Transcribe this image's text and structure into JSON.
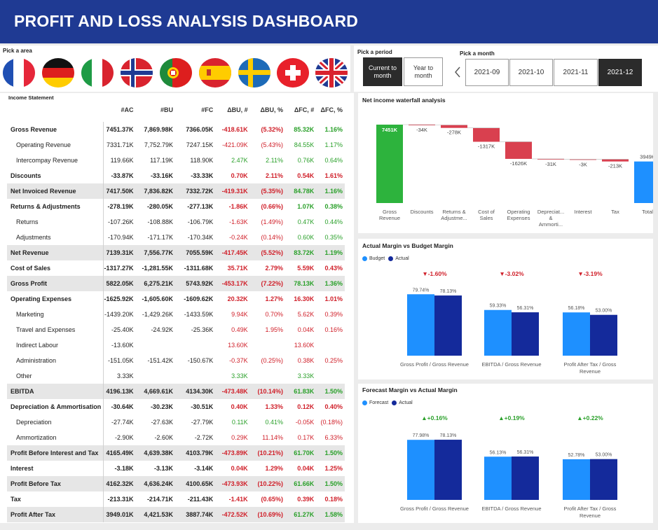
{
  "header": {
    "title": "PROFIT AND LOSS ANALYSIS DASHBOARD"
  },
  "area": {
    "label": "Pick a area",
    "flags": [
      "France",
      "Germany",
      "Italy",
      "Norway",
      "Portugal",
      "Spain",
      "Sweden",
      "Switzerland",
      "United Kingdom"
    ]
  },
  "period": {
    "label": "Pick a period",
    "options": [
      "Current to month",
      "Year to month"
    ],
    "selected": "Current to month"
  },
  "month": {
    "label": "Pick a month",
    "options": [
      "2021-09",
      "2021-10",
      "2021-11",
      "2021-12"
    ],
    "selected": "2021-12",
    "prev_icon": "chevron-left-icon"
  },
  "income": {
    "title": "Income Statement",
    "columns": [
      "#AC",
      "#BU",
      "#FC",
      "ΔBU, #",
      "ΔBU, %",
      "ΔFC, #",
      "ΔFC, %"
    ],
    "rows": [
      {
        "label": "Gross Revenue",
        "vals": [
          "7451.37K",
          "7,869.98K",
          "7366.05K",
          "-418.61K",
          "(5.32%)",
          "85.32K",
          "1.16%"
        ],
        "bold": true,
        "sub": false,
        "shade": false
      },
      {
        "label": "Operating Revenue",
        "vals": [
          "7331.71K",
          "7,752.79K",
          "7247.15K",
          "-421.09K",
          "(5.43%)",
          "84.55K",
          "1.17%"
        ],
        "bold": false,
        "sub": true,
        "shade": false
      },
      {
        "label": "Intercompay Revenue",
        "vals": [
          "119.66K",
          "117.19K",
          "118.90K",
          "2.47K",
          "2.11%",
          "0.76K",
          "0.64%"
        ],
        "bold": false,
        "sub": true,
        "shade": false
      },
      {
        "label": "Discounts",
        "vals": [
          "-33.87K",
          "-33.16K",
          "-33.33K",
          "0.70K",
          "2.11%",
          "0.54K",
          "1.61%"
        ],
        "bold": true,
        "sub": false,
        "shade": false
      },
      {
        "label": "Net Invoiced Revenue",
        "vals": [
          "7417.50K",
          "7,836.82K",
          "7332.72K",
          "-419.31K",
          "(5.35%)",
          "84.78K",
          "1.16%"
        ],
        "bold": true,
        "sub": false,
        "shade": true
      },
      {
        "label": "Returns & Adjustments",
        "vals": [
          "-278.19K",
          "-280.05K",
          "-277.13K",
          "-1.86K",
          "(0.66%)",
          "1.07K",
          "0.38%"
        ],
        "bold": true,
        "sub": false,
        "shade": false
      },
      {
        "label": "Returns",
        "vals": [
          "-107.26K",
          "-108.88K",
          "-106.79K",
          "-1.63K",
          "(1.49%)",
          "0.47K",
          "0.44%"
        ],
        "bold": false,
        "sub": true,
        "shade": false
      },
      {
        "label": "Adjustments",
        "vals": [
          "-170.94K",
          "-171.17K",
          "-170.34K",
          "-0.24K",
          "(0.14%)",
          "0.60K",
          "0.35%"
        ],
        "bold": false,
        "sub": true,
        "shade": false
      },
      {
        "label": "Net Revenue",
        "vals": [
          "7139.31K",
          "7,556.77K",
          "7055.59K",
          "-417.45K",
          "(5.52%)",
          "83.72K",
          "1.19%"
        ],
        "bold": true,
        "sub": false,
        "shade": true
      },
      {
        "label": "Cost of Sales",
        "vals": [
          "-1317.27K",
          "-1,281.55K",
          "-1311.68K",
          "35.71K",
          "2.79%",
          "5.59K",
          "0.43%"
        ],
        "bold": true,
        "sub": false,
        "shade": false
      },
      {
        "label": "Gross Profit",
        "vals": [
          "5822.05K",
          "6,275.21K",
          "5743.92K",
          "-453.17K",
          "(7.22%)",
          "78.13K",
          "1.36%"
        ],
        "bold": true,
        "sub": false,
        "shade": true
      },
      {
        "label": "Operating Expenses",
        "vals": [
          "-1625.92K",
          "-1,605.60K",
          "-1609.62K",
          "20.32K",
          "1.27%",
          "16.30K",
          "1.01%"
        ],
        "bold": true,
        "sub": false,
        "shade": false
      },
      {
        "label": "Marketing",
        "vals": [
          "-1439.20K",
          "-1,429.26K",
          "-1433.59K",
          "9.94K",
          "0.70%",
          "5.62K",
          "0.39%"
        ],
        "bold": false,
        "sub": true,
        "shade": false
      },
      {
        "label": "Travel and Expenses",
        "vals": [
          "-25.40K",
          "-24.92K",
          "-25.36K",
          "0.49K",
          "1.95%",
          "0.04K",
          "0.16%"
        ],
        "bold": false,
        "sub": true,
        "shade": false
      },
      {
        "label": "Indirect Labour",
        "vals": [
          "-13.60K",
          "",
          "",
          "13.60K",
          "",
          "13.60K",
          ""
        ],
        "bold": false,
        "sub": true,
        "shade": false
      },
      {
        "label": "Administration",
        "vals": [
          "-151.05K",
          "-151.42K",
          "-150.67K",
          "-0.37K",
          "(0.25%)",
          "0.38K",
          "0.25%"
        ],
        "bold": false,
        "sub": true,
        "shade": false
      },
      {
        "label": "Other",
        "vals": [
          "3.33K",
          "",
          "",
          "3.33K",
          "",
          "3.33K",
          ""
        ],
        "bold": false,
        "sub": true,
        "shade": false
      },
      {
        "label": "EBITDA",
        "vals": [
          "4196.13K",
          "4,669.61K",
          "4134.30K",
          "-473.48K",
          "(10.14%)",
          "61.83K",
          "1.50%"
        ],
        "bold": true,
        "sub": false,
        "shade": true
      },
      {
        "label": "Depreciation & Ammortisation",
        "vals": [
          "-30.64K",
          "-30.23K",
          "-30.51K",
          "0.40K",
          "1.33%",
          "0.12K",
          "0.40%"
        ],
        "bold": true,
        "sub": false,
        "shade": false
      },
      {
        "label": "Depreciation",
        "vals": [
          "-27.74K",
          "-27.63K",
          "-27.79K",
          "0.11K",
          "0.41%",
          "-0.05K",
          "(0.18%)"
        ],
        "bold": false,
        "sub": true,
        "shade": false
      },
      {
        "label": "Ammortization",
        "vals": [
          "-2.90K",
          "-2.60K",
          "-2.72K",
          "0.29K",
          "11.14%",
          "0.17K",
          "6.33%"
        ],
        "bold": false,
        "sub": true,
        "shade": false
      },
      {
        "label": "Profit Before Interest and Tax",
        "vals": [
          "4165.49K",
          "4,639.38K",
          "4103.79K",
          "-473.89K",
          "(10.21%)",
          "61.70K",
          "1.50%"
        ],
        "bold": true,
        "sub": false,
        "shade": true
      },
      {
        "label": "Interest",
        "vals": [
          "-3.18K",
          "-3.13K",
          "-3.14K",
          "0.04K",
          "1.29%",
          "0.04K",
          "1.25%"
        ],
        "bold": true,
        "sub": false,
        "shade": false
      },
      {
        "label": "Profit Before Tax",
        "vals": [
          "4162.32K",
          "4,636.24K",
          "4100.65K",
          "-473.93K",
          "(10.22%)",
          "61.66K",
          "1.50%"
        ],
        "bold": true,
        "sub": false,
        "shade": true
      },
      {
        "label": "Tax",
        "vals": [
          "-213.31K",
          "-214.71K",
          "-211.43K",
          "-1.41K",
          "(0.65%)",
          "0.39K",
          "0.18%"
        ],
        "bold": true,
        "sub": false,
        "shade": false
      },
      {
        "label": "Profit After Tax",
        "vals": [
          "3949.01K",
          "4,421.53K",
          "3887.74K",
          "-472.52K",
          "(10.69%)",
          "61.27K",
          "1.58%"
        ],
        "bold": true,
        "sub": false,
        "shade": true
      }
    ]
  },
  "colors": {
    "header": "#1f3a93",
    "green": "#2aa02a",
    "red": "#d0202a",
    "pos_bar": "#2db33d",
    "neg_bar": "#d9404f",
    "total_bar": "#1e90ff",
    "light_blue": "#1e90ff",
    "dark_blue": "#142a9b"
  },
  "chart_data": [
    {
      "type": "bar",
      "subtype": "waterfall",
      "title": "Net income waterfall analysis",
      "categories": [
        "Gross Revenue",
        "Discounts",
        "Returns & Adjustme...",
        "Cost of Sales",
        "Operating Expenses",
        "Depreciat... & Ammorti...",
        "Interest",
        "Tax",
        "Total"
      ],
      "values": [
        7451,
        -34,
        -278,
        -1317,
        -1626,
        -31,
        -3,
        -213,
        3949
      ],
      "labels": [
        "7451K",
        "-34K",
        "-278K",
        "-1317K",
        "-1626K",
        "-31K",
        "-3K",
        "-213K",
        "3949K"
      ],
      "ylim": [
        0,
        7451
      ]
    },
    {
      "type": "bar",
      "title": "Actual Margin vs Budget Margin",
      "categories": [
        "Gross Profit / Gross Revenue",
        "EBITDA / Gross Revenue",
        "Profit After Tax / Gross Revenue"
      ],
      "series": [
        {
          "name": "Budget",
          "values": [
            79.74,
            59.33,
            56.18
          ]
        },
        {
          "name": "Actual",
          "values": [
            78.13,
            56.31,
            53.0
          ]
        }
      ],
      "value_labels": [
        [
          "79.74%",
          "59.33%",
          "56.18%"
        ],
        [
          "78.13%",
          "56.31%",
          "53.00%"
        ]
      ],
      "variance": [
        "▼-1.60%",
        "▼-3.02%",
        "▼-3.19%"
      ],
      "variance_dir": [
        "down",
        "down",
        "down"
      ],
      "legend": "top-left"
    },
    {
      "type": "bar",
      "title": "Forecast Margin vs Actual Margin",
      "categories": [
        "Gross Profit / Gross Revenue",
        "EBITDA / Gross Revenue",
        "Profit After Tax / Gross Revenue"
      ],
      "series": [
        {
          "name": "Forecast",
          "values": [
            77.98,
            56.13,
            52.78
          ]
        },
        {
          "name": "Actual",
          "values": [
            78.13,
            56.31,
            53.0
          ]
        }
      ],
      "value_labels": [
        [
          "77.98%",
          "56.13%",
          "52.78%"
        ],
        [
          "78.13%",
          "56.31%",
          "53.00%"
        ]
      ],
      "variance": [
        "▲+0.16%",
        "▲+0.19%",
        "▲+0.22%"
      ],
      "variance_dir": [
        "up",
        "up",
        "up"
      ],
      "legend": "top-left"
    }
  ]
}
